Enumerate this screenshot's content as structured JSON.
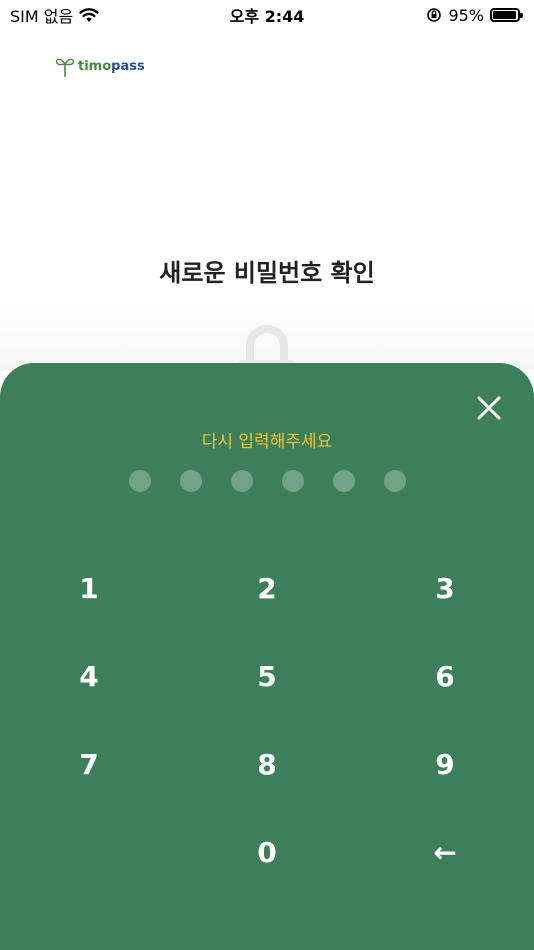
{
  "status_bar": {
    "carrier": "SIM 없음",
    "time": "오후 2:44",
    "battery_percent": "95%",
    "battery_level": 0.95
  },
  "logo": {
    "text_a": "timo",
    "text_b": "pass"
  },
  "page": {
    "title": "새로운 비밀번호 확인"
  },
  "keypad_sheet": {
    "instruction": "다시 입력해주세요",
    "pin_length": 6,
    "entered_count": 0,
    "keys": [
      "1",
      "2",
      "3",
      "4",
      "5",
      "6",
      "7",
      "8",
      "9",
      "0"
    ],
    "backspace_symbol": "←"
  },
  "colors": {
    "sheet_background": "#3d7f5b",
    "instruction_text": "#f2c230",
    "key_text": "#ffffff",
    "title_text": "#222222"
  },
  "icons": {
    "close": "close-icon",
    "lock": "lock-icon",
    "wifi": "wifi-icon",
    "orientation_lock": "orientation-lock-icon",
    "battery": "battery-icon",
    "backspace": "backspace-icon"
  }
}
